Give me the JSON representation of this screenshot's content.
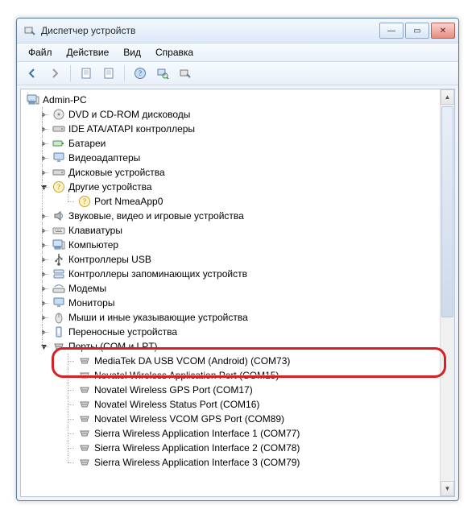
{
  "window": {
    "title": "Диспетчер устройств"
  },
  "menu": {
    "file": "Файл",
    "action": "Действие",
    "view": "Вид",
    "help": "Справка"
  },
  "root": {
    "label": "Admin-PC"
  },
  "cats": {
    "dvd": "DVD и CD-ROM дисководы",
    "ide": "IDE ATA/ATAPI контроллеры",
    "bat": "Батареи",
    "vid": "Видеоадаптеры",
    "disk": "Дисковые устройства",
    "other": "Другие устройства",
    "other_child": "Port NmeaApp0",
    "audio": "Звуковые, видео и игровые устройства",
    "kbd": "Клавиатуры",
    "comp": "Компьютер",
    "usb": "Контроллеры USB",
    "stor": "Контроллеры запоминающих устройств",
    "modem": "Модемы",
    "mon": "Мониторы",
    "hid": "Мыши и иные указывающие устройства",
    "portable": "Переносные устройства",
    "ports": "Порты (COM и LPT)"
  },
  "ports": [
    "MediaTek DA USB VCOM (Android) (COM73)",
    "Novatel Wireless Application Port (COM15)",
    "Novatel Wireless GPS Port (COM17)",
    "Novatel Wireless Status Port (COM16)",
    "Novatel Wireless VCOM GPS Port (COM89)",
    "Sierra Wireless Application Interface 1 (COM77)",
    "Sierra Wireless Application Interface 2 (COM78)",
    "Sierra Wireless Application Interface 3 (COM79)"
  ],
  "highlight_index": 0
}
